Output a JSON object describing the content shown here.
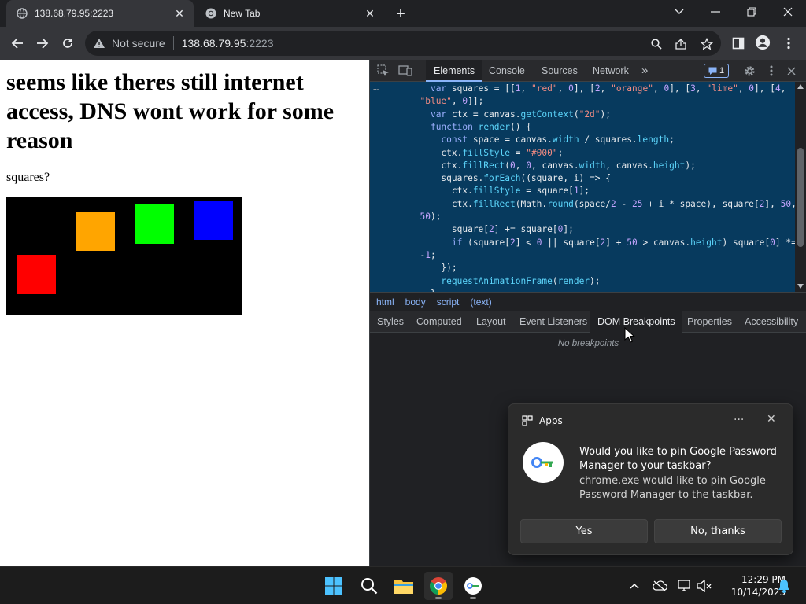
{
  "tabs": [
    {
      "title": "138.68.79.95:2223",
      "active": true
    },
    {
      "title": "New Tab",
      "active": false
    }
  ],
  "omnibox": {
    "security_label": "Not secure",
    "host": "138.68.79.95",
    "port": ":2223"
  },
  "page": {
    "heading": "seems like theres still internet access, DNS wont work for some reason",
    "label": "squares?",
    "squares": [
      {
        "color": "#ff0000"
      },
      {
        "color": "#ffa500"
      },
      {
        "color": "#00ff00"
      },
      {
        "color": "#0000ff"
      }
    ]
  },
  "devtools": {
    "tabs": [
      "Elements",
      "Console",
      "Sources",
      "Network"
    ],
    "active_tab": "Elements",
    "more_tabs": "»",
    "issues_count": "1",
    "ellipsis": "…",
    "code_lines": [
      "    var squares = [[1, \"red\", 0], [2, \"orange\", 0], [3, \"lime\", 0], [4,",
      "  \"blue\", 0]];",
      "    var ctx = canvas.getContext(\"2d\");",
      "    function render() {",
      "      const space = canvas.width / squares.length;",
      "      ctx.fillStyle = \"#000\";",
      "      ctx.fillRect(0, 0, canvas.width, canvas.height);",
      "      squares.forEach((square, i) => {",
      "        ctx.fillStyle = square[1];",
      "        ctx.fillRect(Math.round(space/2 - 25 + i * space), square[2], 50,",
      "  50);",
      "        square[2] += square[0];",
      "        if (square[2] < 0 || square[2] + 50 > canvas.height) square[0] *=",
      "  -1;",
      "      });",
      "      requestAnimationFrame(render);",
      "    }"
    ],
    "breadcrumbs": [
      "html",
      "body",
      "script",
      "(text)"
    ],
    "sub_tabs": [
      "Styles",
      "Computed",
      "Layout",
      "Event Listeners",
      "DOM Breakpoints",
      "Properties",
      "Accessibility"
    ],
    "active_sub_tab": "DOM Breakpoints",
    "empty_message": "No breakpoints"
  },
  "notification": {
    "app": "Apps",
    "more": "···",
    "close": "✕",
    "headline": "Would you like to pin Google Password Manager to your taskbar?",
    "body": "chrome.exe would like to pin Google Password Manager to the taskbar.",
    "yes": "Yes",
    "no": "No, thanks"
  },
  "taskbar": {
    "time": "12:29 PM",
    "date": "10/14/2023"
  },
  "colors": {
    "code_bg": "#073a5e",
    "accent": "#8ab4f8"
  }
}
